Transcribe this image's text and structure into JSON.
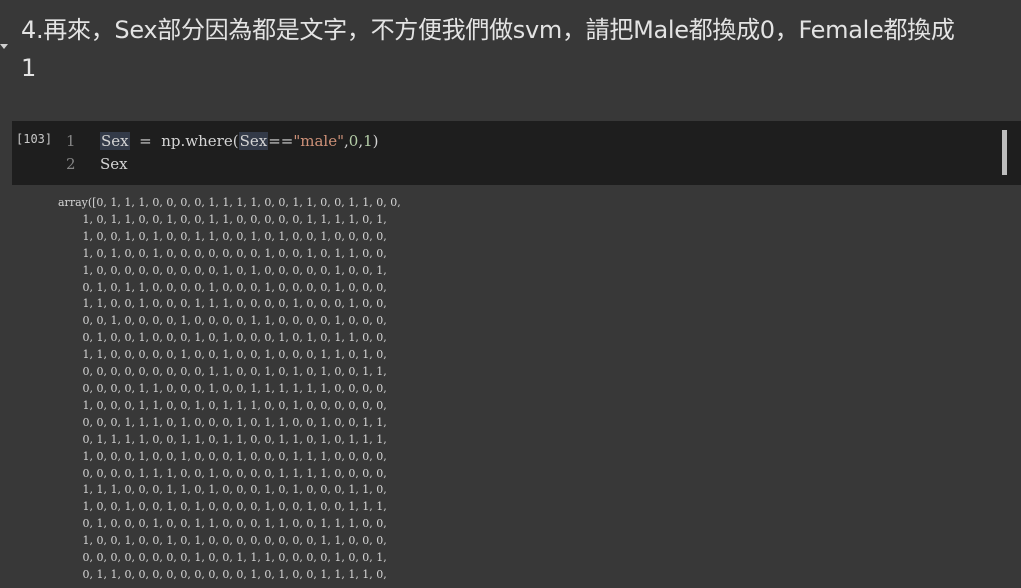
{
  "markdown": {
    "line1": "4.再來，Sex部分因為都是文字，不方便我們做svm，請把Male都換成0，Female都換成",
    "line2": "1"
  },
  "code_cell": {
    "exec_count": "[103]",
    "lines": [
      {
        "num": "1",
        "var": "Sex",
        "op": "  =  ",
        "pre": "np.where(",
        "var2": "Sex",
        "mid": "==",
        "str": "\"male\"",
        "comma1": ",",
        "n0": "0",
        "comma2": ",",
        "n1": "1",
        "close": ")"
      },
      {
        "num": "2",
        "var": "Sex"
      }
    ]
  },
  "output": {
    "lines": [
      "array([0, 1, 1, 1, 0, 0, 0, 0, 1, 1, 1, 1, 0, 0, 1, 1, 0, 0, 1, 1, 0, 0,",
      "       1, 0, 1, 1, 0, 0, 1, 0, 0, 1, 1, 0, 0, 0, 0, 0, 1, 1, 1, 1, 0, 1,",
      "       1, 0, 0, 1, 0, 1, 0, 0, 1, 1, 0, 0, 1, 0, 1, 0, 0, 1, 0, 0, 0, 0,",
      "       1, 0, 1, 0, 0, 1, 0, 0, 0, 0, 0, 0, 0, 1, 0, 0, 1, 0, 1, 1, 0, 0,",
      "       1, 0, 0, 0, 0, 0, 0, 0, 0, 0, 1, 0, 1, 0, 0, 0, 0, 0, 1, 0, 0, 1,",
      "       0, 1, 0, 1, 1, 0, 0, 0, 0, 1, 0, 0, 0, 1, 0, 0, 0, 0, 1, 0, 0, 0,",
      "       1, 1, 0, 0, 1, 0, 0, 0, 1, 1, 1, 0, 0, 0, 0, 1, 0, 0, 0, 1, 0, 0,",
      "       0, 0, 1, 0, 0, 0, 0, 1, 0, 0, 0, 0, 1, 1, 0, 0, 0, 0, 1, 0, 0, 0,",
      "       0, 1, 0, 0, 1, 0, 0, 0, 1, 0, 1, 0, 0, 0, 1, 0, 1, 0, 1, 1, 0, 0,",
      "       1, 1, 0, 0, 0, 0, 0, 1, 0, 0, 1, 0, 0, 1, 0, 0, 0, 1, 1, 0, 1, 0,",
      "       0, 0, 0, 0, 0, 0, 0, 0, 0, 1, 1, 0, 0, 1, 0, 1, 0, 1, 0, 0, 1, 1,",
      "       0, 0, 0, 0, 1, 1, 0, 0, 0, 1, 0, 0, 1, 1, 1, 1, 1, 1, 0, 0, 0, 0,",
      "       1, 0, 0, 0, 1, 1, 0, 0, 1, 0, 1, 1, 1, 0, 0, 1, 0, 0, 0, 0, 0, 0,",
      "       0, 0, 0, 1, 1, 1, 0, 1, 0, 0, 0, 1, 0, 1, 1, 0, 0, 1, 0, 0, 1, 1,",
      "       0, 1, 1, 1, 1, 0, 0, 1, 1, 0, 1, 1, 0, 0, 1, 1, 0, 1, 0, 1, 1, 1,",
      "       1, 0, 0, 0, 1, 0, 0, 1, 0, 0, 0, 1, 0, 0, 0, 1, 1, 1, 0, 0, 0, 0,",
      "       0, 0, 0, 0, 1, 1, 1, 0, 0, 1, 0, 0, 0, 0, 1, 1, 1, 1, 0, 0, 0, 0,",
      "       1, 1, 1, 0, 0, 0, 1, 1, 0, 1, 0, 0, 0, 1, 0, 1, 0, 0, 0, 1, 1, 0,",
      "       1, 0, 0, 1, 0, 0, 1, 0, 1, 0, 0, 0, 0, 1, 0, 0, 1, 0, 0, 1, 1, 1,",
      "       0, 1, 0, 0, 0, 1, 0, 0, 1, 1, 0, 0, 0, 1, 1, 0, 0, 1, 1, 1, 0, 0,",
      "       1, 0, 0, 1, 0, 0, 1, 0, 1, 0, 0, 0, 0, 0, 0, 0, 0, 1, 1, 0, 0, 0,",
      "       0, 0, 0, 0, 0, 0, 0, 0, 1, 0, 0, 1, 1, 1, 0, 0, 0, 0, 1, 0, 0, 1,",
      "       0, 1, 1, 0, 0, 0, 0, 0, 0, 0, 0, 0, 1, 0, 1, 0, 0, 1, 1, 1, 1, 0,"
    ]
  }
}
